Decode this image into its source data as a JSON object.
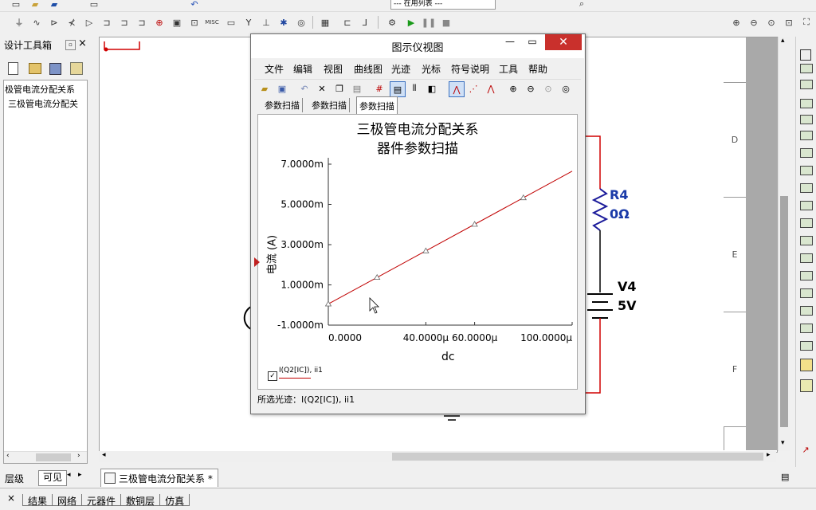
{
  "toolbar": {
    "dropdown_value": "--- 在用列表 ---",
    "misc_label": "MISC"
  },
  "design_toolbox": {
    "title": "设计工具箱",
    "tree_items": [
      "极管电流分配关系",
      "三极管电流分配关"
    ],
    "tabs": [
      "层级",
      "可见"
    ]
  },
  "schematic": {
    "r4_name": "R4",
    "r4_value": "0Ω",
    "v4_name": "V4",
    "v4_value": "5V",
    "ruler_labels": [
      "D",
      "E",
      "F"
    ],
    "doc_tab": "三极管电流分配关系 *"
  },
  "bottom_tabs": [
    "结果",
    "网络",
    "元器件",
    "敷铜层",
    "仿真"
  ],
  "grapher": {
    "title": "图示仪视图",
    "menu": [
      "文件",
      "编辑",
      "视图",
      "曲线图",
      "光迹",
      "光标",
      "符号说明",
      "工具",
      "帮助"
    ],
    "tabs": [
      "参数扫描",
      "参数扫描",
      "参数扫描"
    ],
    "legend": "I(Q2[IC]), ii1",
    "status": "所选光迹：I(Q2[IC]), ii1"
  },
  "chart_data": {
    "type": "line",
    "title": "三极管电流分配关系",
    "subtitle": "器件参数扫描",
    "xlabel": "dc",
    "ylabel": "电流 (A)",
    "x_tick_labels": [
      "0.0000",
      "40.0000μ",
      "60.0000μ",
      "100.0000μ"
    ],
    "y_tick_labels": [
      "7.0000m",
      "5.0000m",
      "3.0000m",
      "1.0000m",
      "-1.0000m"
    ],
    "xlim": [
      0,
      100
    ],
    "ylim": [
      -1,
      7
    ],
    "series": [
      {
        "name": "I(Q2[IC]), ii1",
        "color": "#c00000",
        "x": [
          0,
          100
        ],
        "y": [
          0.05,
          6.65
        ],
        "marker_x": [
          0,
          20,
          40,
          60,
          80
        ],
        "marker_y": [
          0.05,
          1.37,
          2.69,
          4.01,
          5.33
        ]
      }
    ]
  }
}
